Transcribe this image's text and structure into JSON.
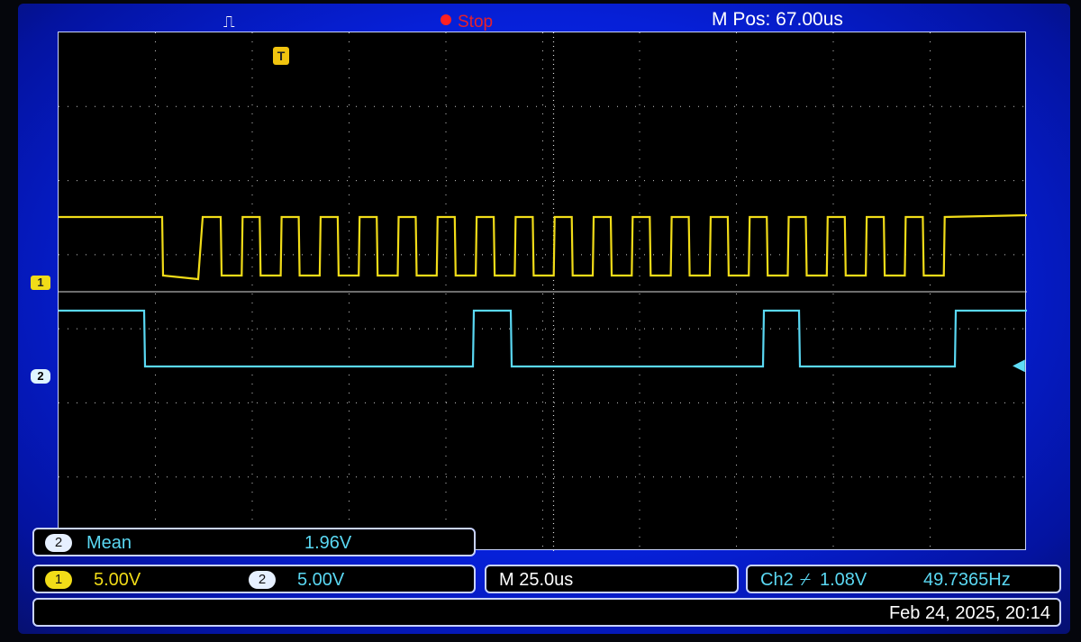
{
  "status": {
    "trigger_icon": "pulse-icon",
    "run_state": "Stop",
    "m_pos": "M Pos: 67.00us"
  },
  "markers": {
    "trigger_marker": "T",
    "ch1_marker": "1",
    "ch2_marker": "2"
  },
  "measurement": {
    "channel": "2",
    "type": "Mean",
    "value": "1.96V"
  },
  "channels": {
    "ch1": {
      "label": "1",
      "scale": "5.00V",
      "color": "#f1dc18"
    },
    "ch2": {
      "label": "2",
      "scale": "5.00V",
      "color": "#5ad8f3"
    }
  },
  "timebase": "M 25.0us",
  "trigger": {
    "source_text": "Ch2",
    "slope_icon": "rising-edge-icon",
    "level": "1.08V",
    "frequency": "49.7365Hz"
  },
  "datetime": "Feb 24, 2025, 20:14"
}
